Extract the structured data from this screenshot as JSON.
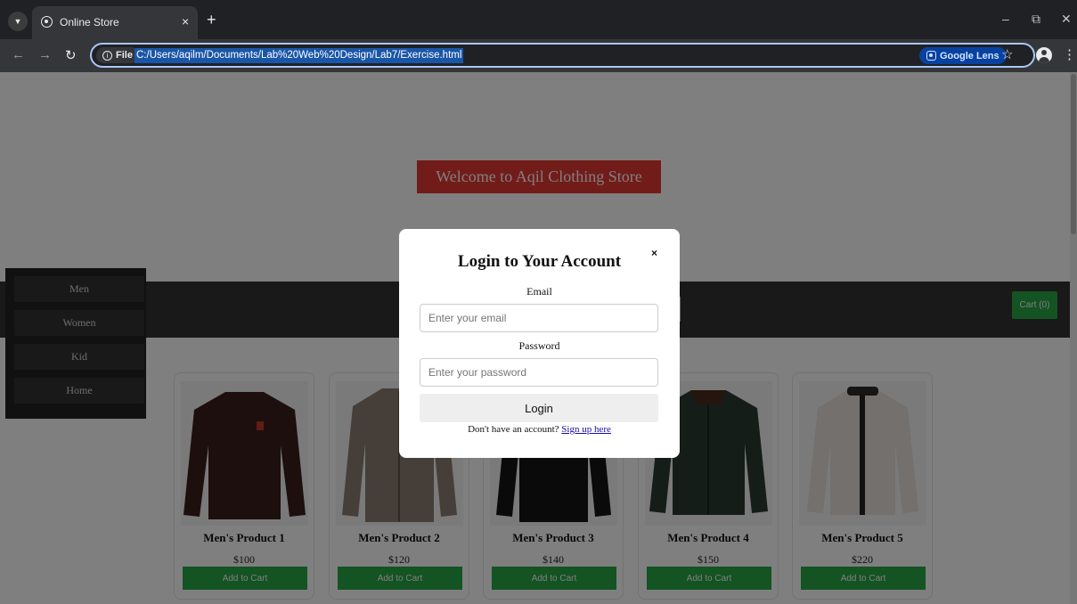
{
  "browser": {
    "tab_title": "Online Store",
    "tab_close": "×",
    "new_tab": "+",
    "site_chip": "File",
    "url": "C:/Users/aqilm/Documents/Lab%20Web%20Design/Lab7/Exercise.html",
    "lens_label": "Google Lens",
    "minimize": "–",
    "restore": "⧉",
    "close": "✕"
  },
  "page": {
    "banner": "Welcome to Aqil Clothing Store",
    "cart_label": "Cart (0)",
    "sidebar": [
      "Men",
      "Women",
      "Kid",
      "Home"
    ],
    "products": [
      {
        "name": "Men's Product 1",
        "price": "$100",
        "button": "Add to Cart",
        "color": "#3b1f1c"
      },
      {
        "name": "Men's Product 2",
        "price": "$120",
        "button": "Add to Cart",
        "color": "#8c7f72"
      },
      {
        "name": "Men's Product 3",
        "price": "$140",
        "button": "Add to Cart",
        "color": "#151515"
      },
      {
        "name": "Men's Product 4",
        "price": "$150",
        "button": "Add to Cart",
        "color": "#2a3a33"
      },
      {
        "name": "Men's Product 5",
        "price": "$220",
        "button": "Add to Cart",
        "color": "#e6e1da"
      }
    ]
  },
  "modal": {
    "title": "Login to Your Account",
    "close": "×",
    "email_label": "Email",
    "email_placeholder": "Enter your email",
    "password_label": "Password",
    "password_placeholder": "Enter your password",
    "login_button": "Login",
    "signup_prompt": "Don't have an account?",
    "signup_link": "Sign up here"
  }
}
